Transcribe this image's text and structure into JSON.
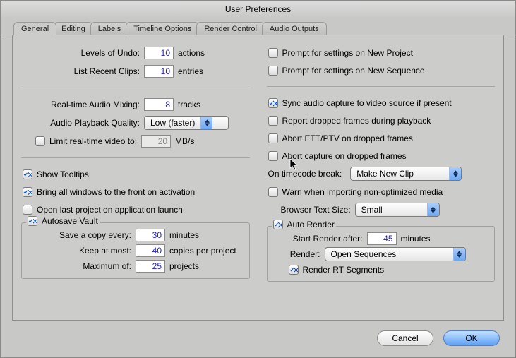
{
  "window": {
    "title": "User Preferences"
  },
  "tabs": {
    "general": "General",
    "editing": "Editing",
    "labels": "Labels",
    "timeline": "Timeline Options",
    "render": "Render Control",
    "audio": "Audio Outputs"
  },
  "left": {
    "undo_label": "Levels of Undo:",
    "undo_value": "10",
    "undo_unit": "actions",
    "recent_label": "List Recent Clips:",
    "recent_value": "10",
    "recent_unit": "entries",
    "mixing_label": "Real-time Audio Mixing:",
    "mixing_value": "8",
    "mixing_unit": "tracks",
    "quality_label": "Audio Playback Quality:",
    "quality_value": "Low (faster)",
    "limit_label": "Limit real-time video to:",
    "limit_value": "20",
    "limit_unit": "MB/s",
    "tooltips": "Show Tooltips",
    "bring_front": "Bring all windows to the front on activation",
    "open_last": "Open last project on application launch",
    "autosave_title": "Autosave Vault",
    "save_every_label": "Save a copy every:",
    "save_every_value": "30",
    "save_every_unit": "minutes",
    "keep_label": "Keep at most:",
    "keep_value": "40",
    "keep_unit": "copies per project",
    "max_label": "Maximum of:",
    "max_value": "25",
    "max_unit": "projects"
  },
  "right": {
    "prompt_project": "Prompt for settings on New Project",
    "prompt_sequence": "Prompt for settings on New Sequence",
    "sync_audio": "Sync audio capture to video source if present",
    "report_dropped": "Report dropped frames during playback",
    "abort_ett": "Abort ETT/PTV on dropped frames",
    "abort_capture": "Abort capture on dropped frames",
    "timecode_label": "On timecode break:",
    "timecode_value": "Make New Clip",
    "warn_import": "Warn when importing non-optimized media",
    "browser_text_label": "Browser Text Size:",
    "browser_text_value": "Small",
    "autorender_title": "Auto Render",
    "start_render_label": "Start Render after:",
    "start_render_value": "45",
    "start_render_unit": "minutes",
    "render_label": "Render:",
    "render_value": "Open Sequences",
    "render_rt": "Render RT Segments"
  },
  "footer": {
    "cancel": "Cancel",
    "ok": "OK"
  }
}
